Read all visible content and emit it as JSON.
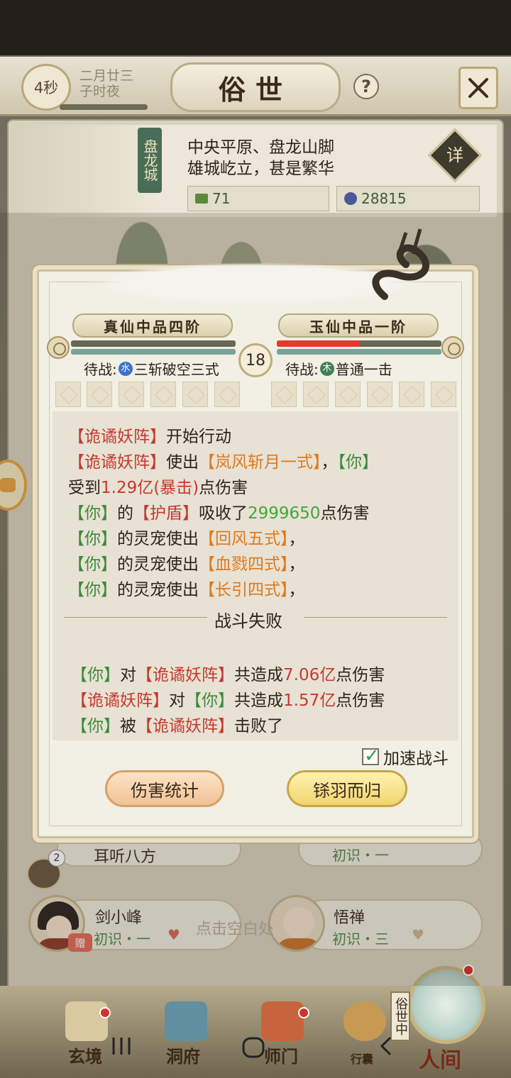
{
  "header": {
    "timer": "4秒",
    "date_line1": "二月廿三",
    "date_line2": "子时夜",
    "title": "俗世",
    "help": "?",
    "time_progress": 0.9
  },
  "location": {
    "city": "盘龙城",
    "desc_line1": "中央平原、盘龙山脚",
    "desc_line2": "雄城屹立，甚是繁华",
    "detail_label": "详",
    "resource1": "71",
    "resource2": "28815"
  },
  "battle": {
    "left_rank": "真仙中品四阶",
    "right_rank": "玉仙中品一阶",
    "turn": "18",
    "left_hp": 0.0,
    "right_hp": 0.5,
    "left_standby_label": "待战:",
    "left_element": "水",
    "left_skill": "三斩破空三式",
    "right_standby_label": "待战:",
    "right_element": "木",
    "right_skill": "普通一击",
    "log": {
      "l1_enemy": "【诡谲妖阵】",
      "l1_text": "开始行动",
      "l2_enemy": "【诡谲妖阵】",
      "l2_text": "使出",
      "l2_skill": "【岚风斩月一式】",
      "l2_comma": "，",
      "l2_you": "【你】",
      "l3_text_a": "受到",
      "l3_dmg": "1.29亿(暴击)",
      "l3_text_b": "点伤害",
      "l4_you": "【你】",
      "l4_text_a": "的",
      "l4_shield": "【护盾】",
      "l4_text_b": "吸收了",
      "l4_num": "2999650",
      "l4_text_c": "点伤害",
      "l5_you": "【你】",
      "l5_text": "的灵宠使出",
      "l5_skill": "【回风五式】",
      "l5_end": "，",
      "l6_you": "【你】",
      "l6_text": "的灵宠使出",
      "l6_skill": "【血戮四式】",
      "l6_end": "，",
      "l7_you": "【你】",
      "l7_text": "的灵宠使出",
      "l7_skill": "【长引四式】",
      "l7_end": "，",
      "result": "战斗失败",
      "s1_you": "【你】",
      "s1_text_a": "对",
      "s1_enemy": "【诡谲妖阵】",
      "s1_text_b": "共造成",
      "s1_num": "7.06亿",
      "s1_text_c": "点伤害",
      "s2_enemy": "【诡谲妖阵】",
      "s2_text_a": "对",
      "s2_you": "【你】",
      "s2_text_b": "共造成",
      "s2_num": "1.57亿",
      "s2_text_c": "点伤害",
      "s3_you": "【你】",
      "s3_text_a": "被",
      "s3_enemy": "【诡谲妖阵】",
      "s3_text_b": "击败了"
    },
    "speed_up_label": "加速战斗",
    "speed_up_checked": true,
    "damage_stats_button": "伤害统计",
    "retreat_button": "铩羽而归"
  },
  "background": {
    "npc1_name": "耳听八方",
    "npc1_rel": "初识・一",
    "npc2_name": "剑小峰",
    "npc2_rel": "初识・一",
    "npc3_name": "悟禅",
    "npc3_rel": "初识・三",
    "gift_tag": "赠",
    "hint": "点击空白处",
    "chat_count": "2",
    "world_tag": "俗世中",
    "world_label": "人间"
  },
  "nav": {
    "item1": "玄境",
    "item2": "洞府",
    "item3": "师门",
    "item4": "行囊"
  },
  "colors": {
    "enemy_red": "#c6392f",
    "you_green": "#3d8a3a",
    "skill_orange": "#e0791d",
    "number_green": "#42a736"
  }
}
